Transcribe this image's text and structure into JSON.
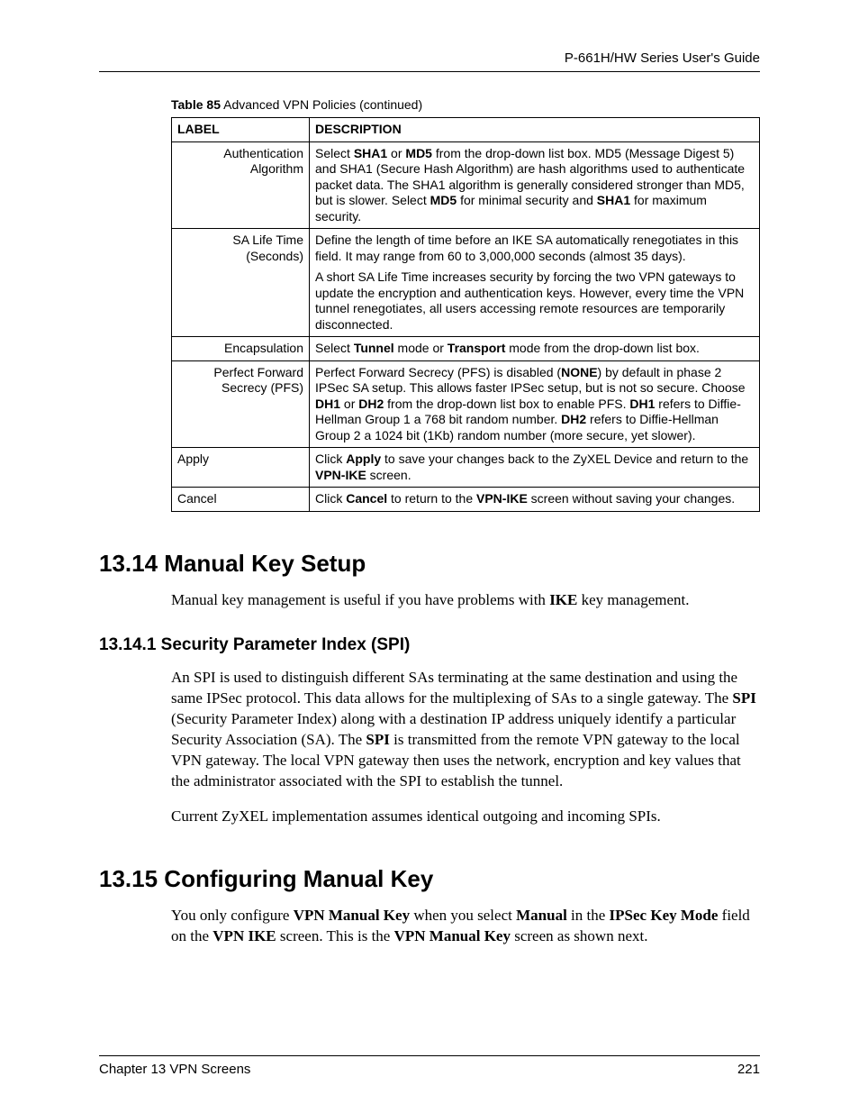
{
  "header": {
    "guide": "P-661H/HW Series User's Guide"
  },
  "table": {
    "caption_label": "Table 85",
    "caption_text": "   Advanced VPN Policies (continued)",
    "head_label": "LABEL",
    "head_desc": "DESCRIPTION",
    "rows": [
      {
        "label": "Authentication Algorithm",
        "desc_html": "Select <b>SHA1</b> or <b>MD5</b> from the drop-down list box. MD5 (Message Digest 5) and SHA1 (Secure Hash Algorithm) are hash algorithms used to authenticate packet data. The SHA1 algorithm is generally considered stronger than MD5, but is slower. Select <b>MD5</b> for minimal security and <b>SHA1</b> for maximum security."
      },
      {
        "label": "SA Life Time (Seconds)",
        "desc_html": "<div class=\"desc-para\">Define the length of time before an IKE SA automatically renegotiates in this field. It may range from 60 to 3,000,000 seconds (almost 35 days).</div><div class=\"desc-para\">A short SA Life Time increases security by forcing the two VPN gateways to update the encryption and authentication keys. However, every time the VPN tunnel renegotiates, all users accessing remote resources are temporarily disconnected.</div>"
      },
      {
        "label": "Encapsulation",
        "desc_html": "Select <b>Tunnel</b> mode or <b>Transport</b> mode from the drop-down list box."
      },
      {
        "label": "Perfect Forward Secrecy (PFS)",
        "desc_html": "Perfect Forward Secrecy (PFS) is disabled (<b>NONE</b>) by default in phase 2 IPSec SA setup. This allows faster IPSec setup, but is not so secure. Choose <b>DH1</b> or <b>DH2</b> from the drop-down list box to enable PFS. <b>DH1</b> refers to Diffie-Hellman Group 1 a 768 bit random number. <b>DH2</b> refers to Diffie-Hellman Group 2 a 1024 bit (1Kb) random number (more secure, yet slower)."
      },
      {
        "label": "Apply",
        "label_align": "left",
        "desc_html": "Click <b>Apply</b> to save your changes back to the ZyXEL Device and return to the <b>VPN-IKE</b> screen."
      },
      {
        "label": "Cancel",
        "label_align": "left",
        "desc_html": "Click <b>Cancel</b> to return to the <b>VPN-IKE</b> screen without saving your changes."
      }
    ]
  },
  "sections": {
    "s1_title": "13.14  Manual Key Setup",
    "s1_p1_html": "Manual key management is useful if you have problems with <b>IKE</b> key management.",
    "s1_1_title": "13.14.1  Security Parameter Index (SPI)",
    "s1_1_p1_html": "An SPI is used to distinguish different SAs terminating at the same destination and using the same IPSec protocol. This data allows for the multiplexing of SAs to a single gateway. The <b>SPI</b> (Security Parameter Index) along with a destination IP address uniquely identify a particular Security Association (SA). The <b>SPI</b> is transmitted from the remote VPN gateway to the local VPN gateway. The local VPN gateway then uses the network, encryption and key values that the administrator associated with the SPI to establish the tunnel.",
    "s1_1_p2": "Current ZyXEL implementation assumes identical outgoing and incoming SPIs.",
    "s2_title": "13.15  Configuring Manual Key",
    "s2_p1_html": "You only configure <b>VPN Manual Key</b> when you select <b>Manual</b> in the <b>IPSec Key Mode</b> field on the <b>VPN IKE</b> screen. This is the <b>VPN Manual Key</b> screen as shown next."
  },
  "footer": {
    "chapter": "Chapter 13 VPN Screens",
    "page": "221"
  }
}
